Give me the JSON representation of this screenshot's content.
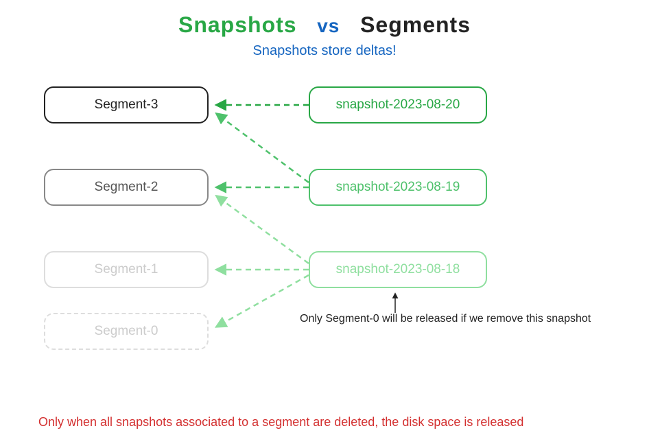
{
  "title": {
    "snapshots": "Snapshots",
    "vs": "vs",
    "segments": "Segments"
  },
  "subtitle": "Snapshots store deltas!",
  "segments": {
    "s3": "Segment-3",
    "s2": "Segment-2",
    "s1": "Segment-1",
    "s0": "Segment-0"
  },
  "snapshots": {
    "n20": "snapshot-2023-08-20",
    "n19": "snapshot-2023-08-19",
    "n18": "snapshot-2023-08-18"
  },
  "annotation": "Only Segment-0 will be released if we remove this snapshot",
  "footer": "Only when all snapshots associated to a segment are deleted, the disk space is released",
  "colors": {
    "green_dark": "#28a745",
    "green_mid": "#4ec16b",
    "green_light": "#8fdf9f",
    "blue": "#1565c0",
    "red": "#d32f2f"
  }
}
